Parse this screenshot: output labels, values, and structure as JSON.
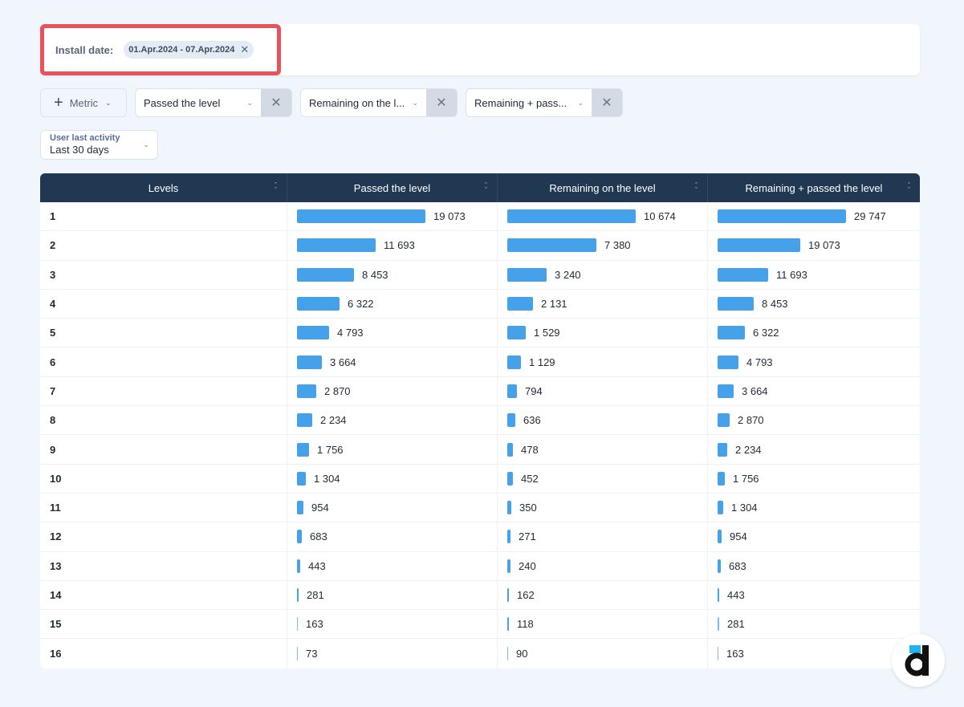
{
  "filters": {
    "install_date_label": "Install date:",
    "install_date_value": "01.Apr.2024 - 07.Apr.2024"
  },
  "metrics": {
    "add_label": "Metric",
    "selected": [
      {
        "label": "Passed the level"
      },
      {
        "label": "Remaining on the l..."
      },
      {
        "label": "Remaining + pass..."
      }
    ]
  },
  "activity": {
    "label": "User last activity",
    "value": "Last 30 days"
  },
  "table": {
    "columns": [
      "Levels",
      "Passed the level",
      "Remaining on the level",
      "Remaining + passed the level"
    ],
    "rows": [
      {
        "level": "1",
        "passed": 19073,
        "remaining": 10674,
        "total": 29747,
        "passed_text": "19 073",
        "remaining_text": "10 674",
        "total_text": "29 747"
      },
      {
        "level": "2",
        "passed": 11693,
        "remaining": 7380,
        "total": 19073,
        "passed_text": "11 693",
        "remaining_text": "7 380",
        "total_text": "19 073"
      },
      {
        "level": "3",
        "passed": 8453,
        "remaining": 3240,
        "total": 11693,
        "passed_text": "8 453",
        "remaining_text": "3 240",
        "total_text": "11 693"
      },
      {
        "level": "4",
        "passed": 6322,
        "remaining": 2131,
        "total": 8453,
        "passed_text": "6 322",
        "remaining_text": "2 131",
        "total_text": "8 453"
      },
      {
        "level": "5",
        "passed": 4793,
        "remaining": 1529,
        "total": 6322,
        "passed_text": "4 793",
        "remaining_text": "1 529",
        "total_text": "6 322"
      },
      {
        "level": "6",
        "passed": 3664,
        "remaining": 1129,
        "total": 4793,
        "passed_text": "3 664",
        "remaining_text": "1 129",
        "total_text": "4 793"
      },
      {
        "level": "7",
        "passed": 2870,
        "remaining": 794,
        "total": 3664,
        "passed_text": "2 870",
        "remaining_text": "794",
        "total_text": "3 664"
      },
      {
        "level": "8",
        "passed": 2234,
        "remaining": 636,
        "total": 2870,
        "passed_text": "2 234",
        "remaining_text": "636",
        "total_text": "2 870"
      },
      {
        "level": "9",
        "passed": 1756,
        "remaining": 478,
        "total": 2234,
        "passed_text": "1 756",
        "remaining_text": "478",
        "total_text": "2 234"
      },
      {
        "level": "10",
        "passed": 1304,
        "remaining": 452,
        "total": 1756,
        "passed_text": "1 304",
        "remaining_text": "452",
        "total_text": "1 756"
      },
      {
        "level": "11",
        "passed": 954,
        "remaining": 350,
        "total": 1304,
        "passed_text": "954",
        "remaining_text": "350",
        "total_text": "1 304"
      },
      {
        "level": "12",
        "passed": 683,
        "remaining": 271,
        "total": 954,
        "passed_text": "683",
        "remaining_text": "271",
        "total_text": "954"
      },
      {
        "level": "13",
        "passed": 443,
        "remaining": 240,
        "total": 683,
        "passed_text": "443",
        "remaining_text": "240",
        "total_text": "683"
      },
      {
        "level": "14",
        "passed": 281,
        "remaining": 162,
        "total": 443,
        "passed_text": "281",
        "remaining_text": "162",
        "total_text": "443"
      },
      {
        "level": "15",
        "passed": 163,
        "remaining": 118,
        "total": 281,
        "passed_text": "163",
        "remaining_text": "118",
        "total_text": "281"
      },
      {
        "level": "16",
        "passed": 73,
        "remaining": 90,
        "total": 163,
        "passed_text": "73",
        "remaining_text": "90",
        "total_text": "163"
      }
    ]
  },
  "colors": {
    "bar": "#45a2ea",
    "header": "#213852",
    "highlight": "#e8525a"
  },
  "logo": {
    "name": "devtodev-logo"
  }
}
